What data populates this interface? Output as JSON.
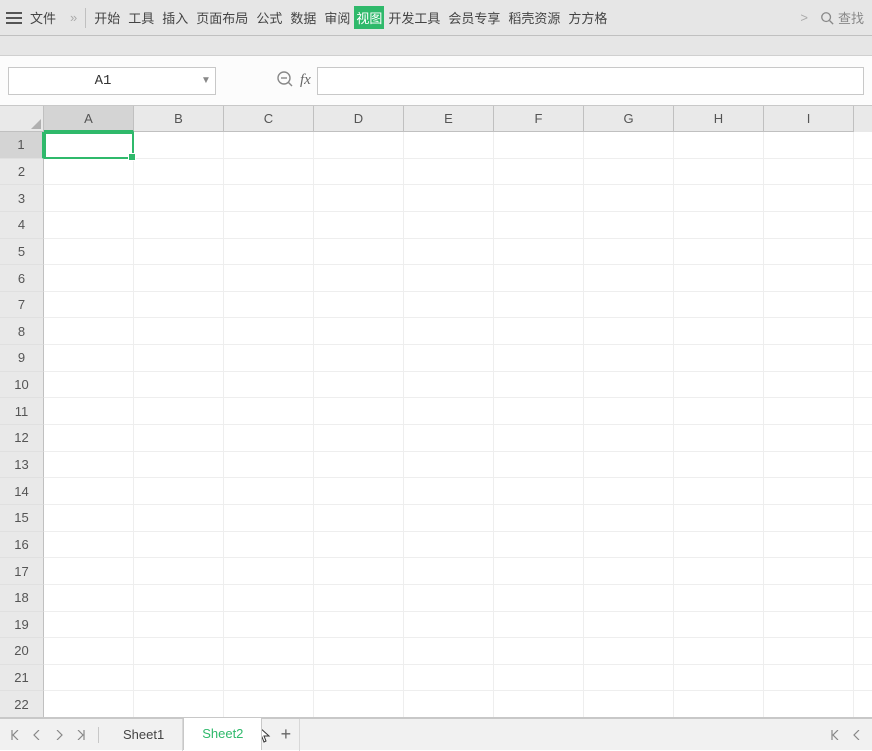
{
  "menu": {
    "file": "文件",
    "more": "»"
  },
  "ribbon": {
    "tabs": [
      "开始",
      "工具",
      "插入",
      "页面布局",
      "公式",
      "数据",
      "审阅",
      "视图",
      "开发工具",
      "会员专享",
      "稻壳资源",
      "方方格"
    ],
    "active_index": 7,
    "overflow": ">"
  },
  "search": {
    "label": "查找"
  },
  "name_box": {
    "value": "A1"
  },
  "fx_label": "fx",
  "columns": [
    "A",
    "B",
    "C",
    "D",
    "E",
    "F",
    "G",
    "H",
    "I"
  ],
  "rows": [
    "1",
    "2",
    "3",
    "4",
    "5",
    "6",
    "7",
    "8",
    "9",
    "10",
    "11",
    "12",
    "13",
    "14",
    "15",
    "16",
    "17",
    "18",
    "19",
    "20",
    "21",
    "22"
  ],
  "active_cell": {
    "col": "A",
    "row": "1"
  },
  "sheets": {
    "tabs": [
      "Sheet1",
      "Sheet2"
    ],
    "active_index": 1,
    "add": "+"
  }
}
